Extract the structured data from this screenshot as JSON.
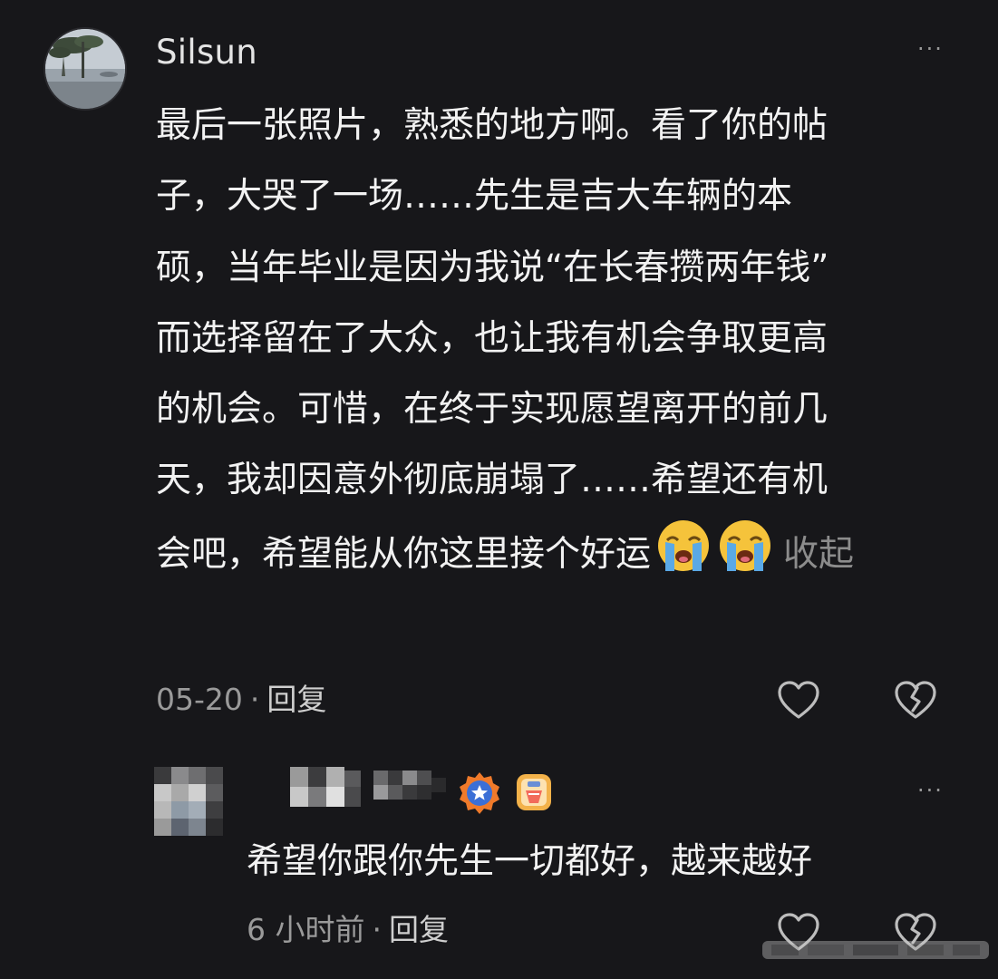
{
  "comment": {
    "username": "Silsun",
    "lines": [
      "最后一张照片，熟悉的地方啊。看了你的帖",
      "子，大哭了一场……先生是吉大车辆的本",
      "硕，当年毕业是因为我说“在长春攒两年钱”",
      "而选择留在了大众，也让我有机会争取更高",
      "的机会。可惜，在终于实现愿望离开的前几",
      "天，我却因意外彻底崩塌了……希望还有机",
      "会吧，希望能从你这里接个好运"
    ],
    "collapse_label": "收起",
    "date": "05-20",
    "reply_label": "回复",
    "more_label": "···"
  },
  "reply": {
    "text": "希望你跟你先生一切都好，越来越好",
    "time": "6 小时前",
    "reply_label": "回复",
    "more_label": "···"
  },
  "colors": {
    "background": "#17171a",
    "text": "#f2f2f2",
    "muted": "#9a9a9a"
  }
}
